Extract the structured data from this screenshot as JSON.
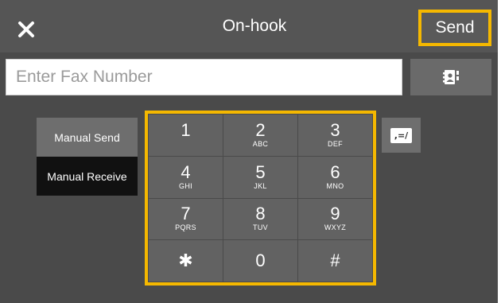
{
  "header": {
    "title": "On-hook",
    "send_label": "Send",
    "close_icon": "close-icon"
  },
  "fax_input": {
    "placeholder": "Enter Fax Number",
    "value": ""
  },
  "address_book_icon": "address-book-icon",
  "side_buttons": {
    "manual_send": "Manual Send",
    "manual_receive": "Manual Receive"
  },
  "keypad": {
    "keys": [
      {
        "num": "1",
        "letters": ""
      },
      {
        "num": "2",
        "letters": "ABC"
      },
      {
        "num": "3",
        "letters": "DEF"
      },
      {
        "num": "4",
        "letters": "GHI"
      },
      {
        "num": "5",
        "letters": "JKL"
      },
      {
        "num": "6",
        "letters": "MNO"
      },
      {
        "num": "7",
        "letters": "PQRS"
      },
      {
        "num": "8",
        "letters": "TUV"
      },
      {
        "num": "9",
        "letters": "WXYZ"
      },
      {
        "num": "✱",
        "letters": ""
      },
      {
        "num": "0",
        "letters": ""
      },
      {
        "num": "#",
        "letters": ""
      }
    ]
  },
  "pause_button": {
    "glyph": ",=/"
  },
  "colors": {
    "highlight": "#f5b800",
    "background": "#4a4a4a",
    "key": "#626262",
    "selected": "#111111"
  }
}
